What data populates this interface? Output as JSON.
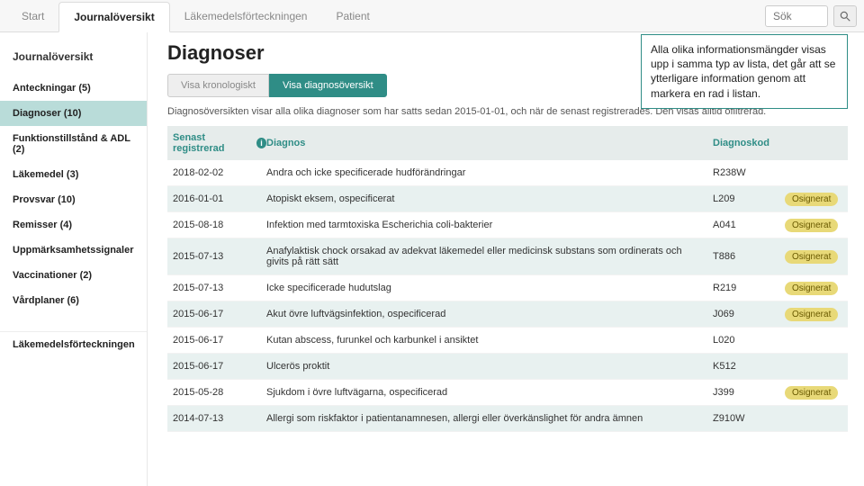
{
  "top_tabs": [
    {
      "label": "Start",
      "active": false
    },
    {
      "label": "Journalöversikt",
      "active": true
    },
    {
      "label": "Läkemedelsförteckningen",
      "active": false
    },
    {
      "label": "Patient",
      "active": false
    }
  ],
  "search": {
    "placeholder": "Sök"
  },
  "sidebar": {
    "header": "Journalöversikt",
    "items": [
      {
        "label": "Anteckningar (5)",
        "selected": false
      },
      {
        "label": "Diagnoser (10)",
        "selected": true
      },
      {
        "label": "Funktionstillstånd & ADL (2)",
        "selected": false
      },
      {
        "label": "Läkemedel (3)",
        "selected": false
      },
      {
        "label": "Provsvar (10)",
        "selected": false
      },
      {
        "label": "Remisser (4)",
        "selected": false
      },
      {
        "label": "Uppmärksamhetssignaler",
        "selected": false
      },
      {
        "label": "Vaccinationer (2)",
        "selected": false
      },
      {
        "label": "Vårdplaner (6)",
        "selected": false
      }
    ],
    "section2_label": "Läkemedelsförteckningen"
  },
  "main": {
    "title": "Diagnoser",
    "view_tabs": [
      {
        "label": "Visa kronologiskt",
        "active": false
      },
      {
        "label": "Visa diagnosöversikt",
        "active": true
      }
    ],
    "description": "Diagnosöversikten visar alla olika diagnoser som har satts sedan 2015-01-01, och när de senast registrerades. Den visas alltid ofiltrerad.",
    "callout": "Alla olika informationsmängder visas upp i samma typ av lista, det går att se ytterligare information genom att markera en rad i listan.",
    "columns": {
      "date": "Senast registrerad",
      "diag": "Diagnos",
      "code": "Diagnoskod"
    },
    "badge_text": "Osignerat",
    "rows": [
      {
        "date": "2018-02-02",
        "diag": "Andra och icke specificerade hudförändringar",
        "code": "R238W",
        "badge": false,
        "alt": false
      },
      {
        "date": "2016-01-01",
        "diag": "Atopiskt eksem, ospecificerat",
        "code": "L209",
        "badge": true,
        "alt": true
      },
      {
        "date": "2015-08-18",
        "diag": "Infektion med tarmtoxiska Escherichia coli-bakterier",
        "code": "A041",
        "badge": true,
        "alt": false
      },
      {
        "date": "2015-07-13",
        "diag": "Anafylaktisk chock orsakad av adekvat läkemedel eller medicinsk substans som ordinerats och givits på rätt sätt",
        "code": "T886",
        "badge": true,
        "alt": true
      },
      {
        "date": "2015-07-13",
        "diag": "Icke specificerade hudutslag",
        "code": "R219",
        "badge": true,
        "alt": false
      },
      {
        "date": "2015-06-17",
        "diag": "Akut övre luftvägsinfektion, ospecificerad",
        "code": "J069",
        "badge": true,
        "alt": true
      },
      {
        "date": "2015-06-17",
        "diag": "Kutan abscess, furunkel och karbunkel i ansiktet",
        "code": "L020",
        "badge": false,
        "alt": false
      },
      {
        "date": "2015-06-17",
        "diag": "Ulcerös proktit",
        "code": "K512",
        "badge": false,
        "alt": true
      },
      {
        "date": "2015-05-28",
        "diag": "Sjukdom i övre luftvägarna, ospecificerad",
        "code": "J399",
        "badge": true,
        "alt": false
      },
      {
        "date": "2014-07-13",
        "diag": "Allergi som riskfaktor i patientanamnesen, allergi eller överkänslighet för andra ämnen",
        "code": "Z910W",
        "badge": false,
        "alt": true
      }
    ]
  }
}
